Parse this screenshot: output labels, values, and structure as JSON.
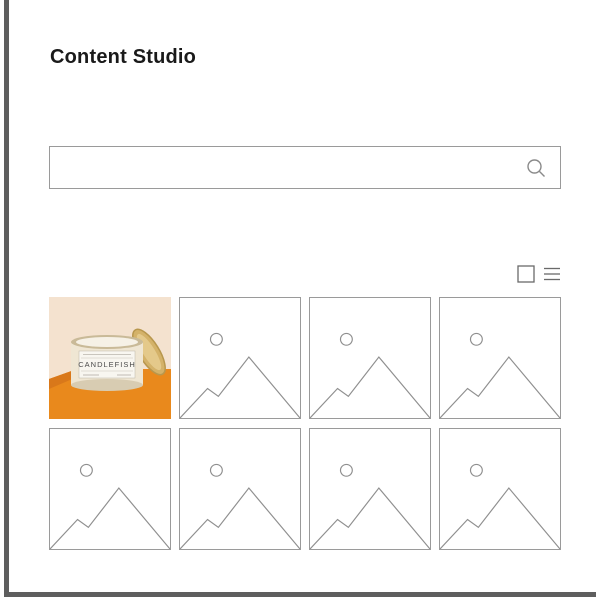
{
  "app": {
    "title": "Content Studio"
  },
  "search": {
    "value": "",
    "placeholder": ""
  },
  "view_toggle": {
    "grid_icon": "grid-view-icon",
    "list_icon": "list-view-icon"
  },
  "tiles": [
    {
      "type": "photo",
      "product_label": "CANDLEFISH"
    },
    {
      "type": "placeholder"
    },
    {
      "type": "placeholder"
    },
    {
      "type": "placeholder"
    },
    {
      "type": "placeholder"
    },
    {
      "type": "placeholder"
    },
    {
      "type": "placeholder"
    },
    {
      "type": "placeholder"
    }
  ],
  "colors": {
    "frame": "#5e5e5e",
    "border": "#9a9a9a",
    "photo_bg_top": "#f4e2cf",
    "photo_bg_bottom": "#e98a1d"
  }
}
